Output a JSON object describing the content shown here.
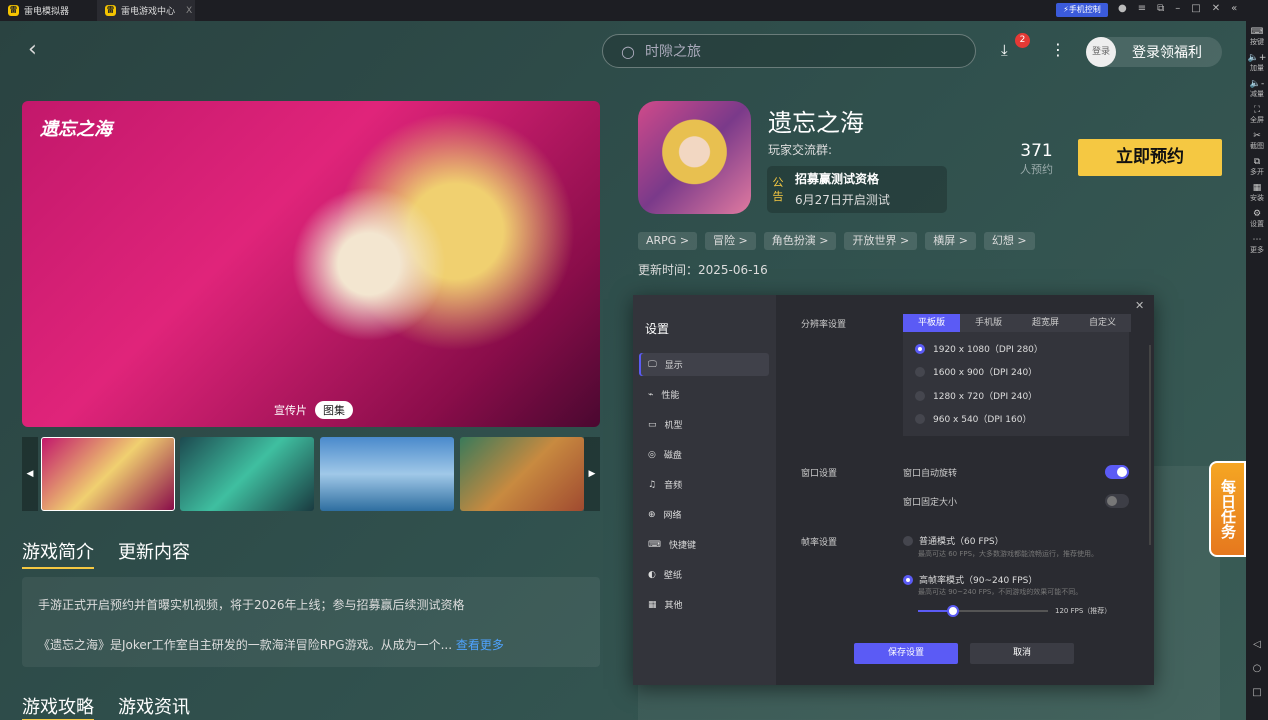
{
  "titlebar": {
    "tabs": [
      {
        "label": "雷电模拟器"
      },
      {
        "label": "雷电游戏中心"
      }
    ],
    "close_tab": "X",
    "phone_control": "手机控制"
  },
  "rightbar": [
    {
      "label": "按键",
      "icon": "keyboard-icon"
    },
    {
      "label": "加量",
      "icon": "volume-up-icon"
    },
    {
      "label": "减量",
      "icon": "volume-down-icon"
    },
    {
      "label": "全屏",
      "icon": "fullscreen-icon"
    },
    {
      "label": "截图",
      "icon": "scissors-icon"
    },
    {
      "label": "多开",
      "icon": "multi-instance-icon"
    },
    {
      "label": "安装",
      "icon": "install-icon"
    },
    {
      "label": "设置",
      "icon": "gear-icon"
    },
    {
      "label": "更多",
      "icon": "more-icon"
    }
  ],
  "header": {
    "search_placeholder": "时隙之旅",
    "download_badge": "2",
    "avatar_label": "登录",
    "login_label": "登录领福利"
  },
  "game": {
    "title": "遗忘之海",
    "group_label": "玩家交流群:",
    "notice_tag": "公告",
    "notice_title": "招募赢测试资格",
    "notice_date": "6月27日开启测试",
    "reserve_count": "371",
    "reserve_label": "人预约",
    "reserve_button": "立即预约",
    "tags": [
      "ARPG >",
      "冒险 >",
      "角色扮演 >",
      "开放世界 >",
      "横屏 >",
      "幻想 >"
    ],
    "update_time": "更新时间：2025-06-16"
  },
  "media": {
    "tab_video": "宣传片",
    "tab_gallery": "图集",
    "hero_logo": "遗忘之海"
  },
  "intro": {
    "tabs": [
      "游戏简介",
      "更新内容"
    ],
    "line1": "手游正式开启预约并首曝实机视频，将于2026年上线；参与招募赢后续测试资格",
    "line2": "《遗忘之海》是Joker工作室自主研发的一款海洋冒险RPG游戏。从成为一个...",
    "more": "查看更多"
  },
  "bottom_tabs": [
    "游戏攻略",
    "游戏资讯"
  ],
  "daily_task": "每日任务",
  "settings": {
    "title": "设置",
    "menu": [
      {
        "label": "显示",
        "icon": "monitor-icon"
      },
      {
        "label": "性能",
        "icon": "performance-icon"
      },
      {
        "label": "机型",
        "icon": "device-icon"
      },
      {
        "label": "磁盘",
        "icon": "disk-icon"
      },
      {
        "label": "音频",
        "icon": "audio-icon"
      },
      {
        "label": "网络",
        "icon": "globe-icon"
      },
      {
        "label": "快捷键",
        "icon": "keyboard-icon"
      },
      {
        "label": "壁纸",
        "icon": "palette-icon"
      },
      {
        "label": "其他",
        "icon": "grid-icon"
      }
    ],
    "resolution_label": "分辨率设置",
    "res_tabs": [
      "平板版",
      "手机版",
      "超宽屏",
      "自定义"
    ],
    "resolutions": [
      "1920 x 1080（DPI 280）",
      "1600 x 900（DPI 240）",
      "1280 x 720（DPI 240）",
      "960 x 540（DPI 160）"
    ],
    "window_label": "窗口设置",
    "auto_rotate": "窗口自动旋转",
    "auto_rotate_on": true,
    "fixed_size": "窗口固定大小",
    "fixed_size_on": false,
    "fps_label": "帧率设置",
    "normal_mode": "普通模式（60 FPS）",
    "normal_desc": "最高可达 60 FPS，大多数游戏都能流畅运行，推荐使用。",
    "high_mode": "高帧率模式（90~240 FPS）",
    "high_desc": "最高可达 90~240 FPS，不同游戏的效果可能不同。",
    "fps_value": "120 FPS（推荐）",
    "fps_slider_fraction": 0.27,
    "save": "保存设置",
    "cancel": "取消"
  }
}
